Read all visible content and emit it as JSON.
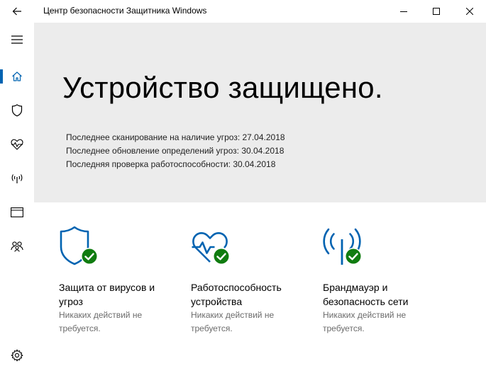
{
  "window": {
    "title": "Центр безопасности Защитника Windows"
  },
  "sidebar": {
    "items": [
      {
        "icon": "hamburger-menu-icon"
      },
      {
        "icon": "home-icon",
        "active": true
      },
      {
        "icon": "shield-icon"
      },
      {
        "icon": "heart-pulse-icon"
      },
      {
        "icon": "wifi-antenna-icon"
      },
      {
        "icon": "browser-window-icon"
      },
      {
        "icon": "family-icon"
      },
      {
        "icon": "gear-icon"
      }
    ]
  },
  "hero": {
    "title": "Устройство защищено.",
    "lines": [
      "Последнее сканирование на наличие угроз:  27.04.2018",
      "Последнее обновление определений угроз:  30.04.2018",
      "Последняя проверка работоспособности:  30.04.2018"
    ]
  },
  "tiles": [
    {
      "title": "Защита от вирусов и угроз",
      "subtitle": "Никаких действий не требуется.",
      "icon": "shield-check-icon"
    },
    {
      "title": "Работоспособность устройства",
      "subtitle": "Никаких действий не требуется.",
      "icon": "heart-check-icon"
    },
    {
      "title": "Брандмауэр и безопасность сети",
      "subtitle": "Никаких действий не требуется.",
      "icon": "antenna-check-icon"
    }
  ],
  "colors": {
    "accent": "#0063b1",
    "ok_green": "#107c10",
    "hero_bg": "#ececec"
  }
}
